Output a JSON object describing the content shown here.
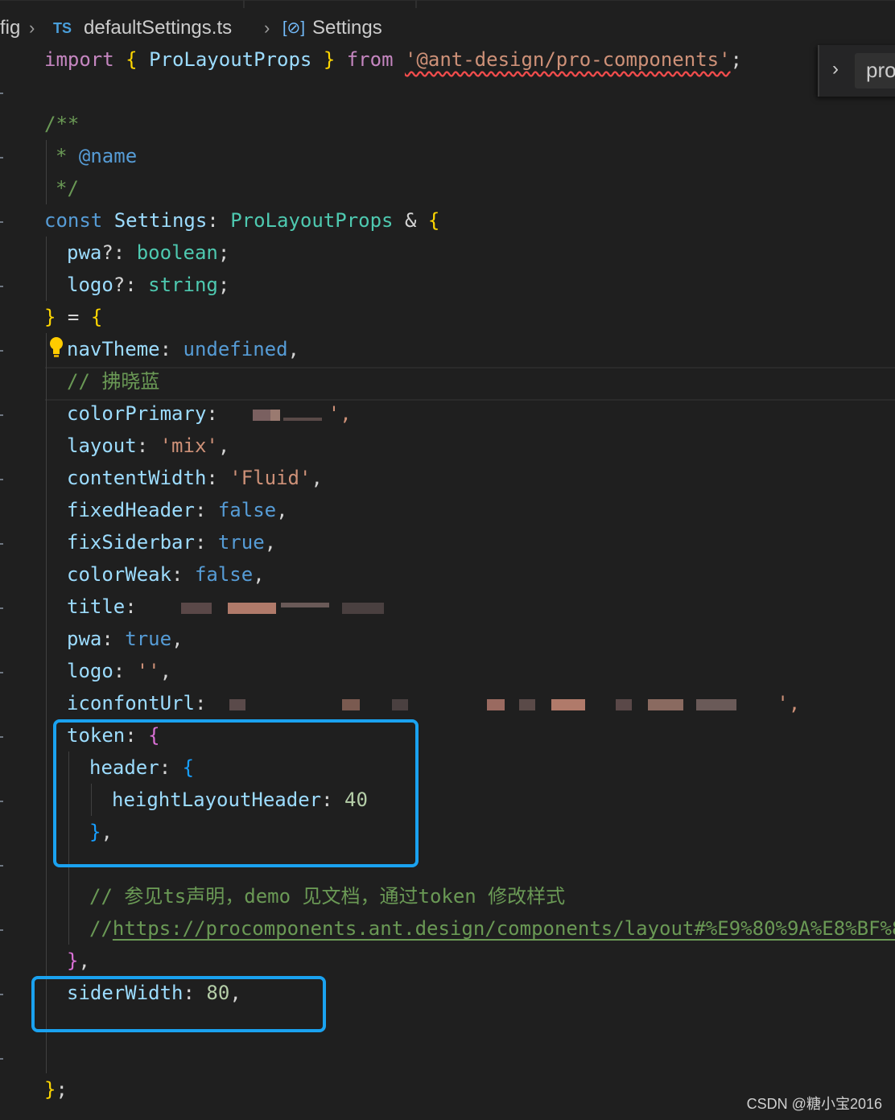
{
  "breadcrumb": {
    "folder": "fig",
    "file_badge": "TS",
    "file_name": "defaultSettings.ts",
    "symbol_icon": "[⊘]",
    "symbol": "Settings"
  },
  "sticky_scroll": {
    "chevron": "›",
    "label": "pro"
  },
  "code": {
    "import_kw": "import",
    "import_name": "ProLayoutProps",
    "from_kw": "from",
    "module": "'@ant-design/pro-components'",
    "doc_open": "/**",
    "doc_star": "*",
    "doc_tag": "@name",
    "doc_close": "*/",
    "const_kw": "const",
    "var_name": "Settings",
    "type_name": "ProLayoutProps",
    "pwa_prop": "pwa",
    "boolean_type": "boolean",
    "logo_prop": "logo",
    "string_type": "string",
    "navTheme_key": "navTheme",
    "undefined_val": "undefined",
    "comment_blue": "// 拂晓蓝",
    "colorPrimary_key": "colorPrimary",
    "colorPrimary_tail": "',",
    "layout_key": "layout",
    "layout_val": "'mix'",
    "contentWidth_key": "contentWidth",
    "contentWidth_val": "'Fluid'",
    "fixedHeader_key": "fixedHeader",
    "fixedHeader_val": "false",
    "fixSiderbar_key": "fixSiderbar",
    "fixSiderbar_val": "true",
    "colorWeak_key": "colorWeak",
    "colorWeak_val": "false",
    "title_key": "title",
    "pwa_key": "pwa",
    "pwa_val": "true",
    "logo_key": "logo",
    "logo_val": "''",
    "iconfontUrl_key": "iconfontUrl",
    "iconfontUrl_tail": "',",
    "token_key": "token",
    "header_key": "header",
    "heightLayoutHeader_key": "heightLayoutHeader",
    "heightLayoutHeader_val": "40",
    "comment_token": "// 参见ts声明，demo 见文档，通过token 修改样式",
    "comment_url_prefix": "//",
    "comment_url": "https://procomponents.ant.design/components/layout#%E9%80%9A%E8%BF%8",
    "siderWidth_key": "siderWidth",
    "siderWidth_val": "80"
  },
  "watermark": "CSDN @糖小宝2016"
}
